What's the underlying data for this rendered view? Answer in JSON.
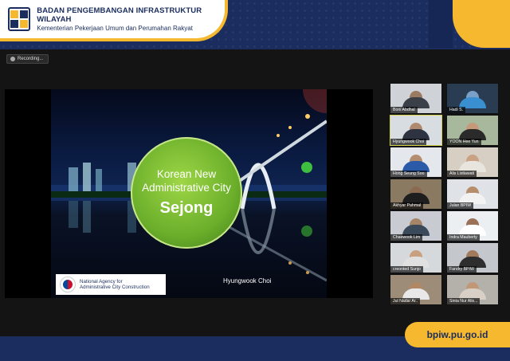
{
  "header": {
    "org_title": "BADAN PENGEMBANGAN INFRASTRUKTUR WILAYAH",
    "org_subtitle": "Kementerian Pekerjaan Umum dan Perumahan Rakyat"
  },
  "colors": {
    "brand_navy": "#1a2d5e",
    "brand_yellow": "#f5b82e",
    "slide_green": "#6aae2a",
    "active_speaker": "#d7d44a"
  },
  "meeting": {
    "recording_label": "Recording...",
    "recording_icon": "recording-icon",
    "slide": {
      "title_line1": "Korean New",
      "title_line2": "Administrative City",
      "title_line3": "Sejong",
      "agency_line1": "National Agency for",
      "agency_line2": "Administrative City Construction",
      "presenter": "Hyungwook Choi"
    },
    "participants": [
      {
        "name": "Boni Abdhal"
      },
      {
        "name": "Hadi S."
      },
      {
        "name": "Hyungwook Choi"
      },
      {
        "name": "YOON Hee Yun"
      },
      {
        "name": "Hong Seung Soo"
      },
      {
        "name": "Alis Listiawati"
      },
      {
        "name": "Akhyar Pahmal"
      },
      {
        "name": "Julan BPIW"
      },
      {
        "name": "Chaewook Lim"
      },
      {
        "name": "Indra Mauberty"
      },
      {
        "name": "creonted Sunjo"
      },
      {
        "name": "Fandry BPIW"
      },
      {
        "name": "Jul Nadar Ar.."
      },
      {
        "name": "Sinta Nur Alis..."
      }
    ]
  },
  "footer": {
    "website": "bpiw.pu.go.id"
  }
}
